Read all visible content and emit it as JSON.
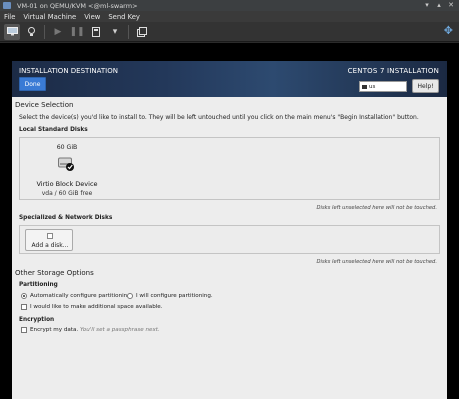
{
  "window": {
    "title": "VM-01 on QEMU/KVM <@ml-swarm>",
    "controls": [
      "▾",
      "▴",
      "✕"
    ]
  },
  "menu": [
    "File",
    "Virtual Machine",
    "View",
    "Send Key"
  ],
  "toolbar": {
    "icons": [
      "monitor-icon",
      "lightbulb-icon",
      "play-icon",
      "pause-icon",
      "power-icon",
      "dropdown-icon",
      "snapshot-icon",
      "resize-icon"
    ]
  },
  "installer": {
    "header_title": "INSTALLATION DESTINATION",
    "done_label": "Done",
    "product": "CENTOS 7 INSTALLATION",
    "keyboard_layout": "us",
    "help_label": "Help!",
    "device_selection_title": "Device Selection",
    "device_selection_desc": "Select the device(s) you'd like to install to.  They will be left untouched until you click on the main menu's \"Begin Installation\" button.",
    "local_disks_label": "Local Standard Disks",
    "disk": {
      "size": "60 GiB",
      "name": "Virtio Block Device",
      "info": "vda  /  60 GiB free"
    },
    "untouched_note": "Disks left unselected here will not be touched.",
    "specialized_label": "Specialized & Network Disks",
    "add_disk_label": "Add a disk...",
    "untouched_note_2": "Disks left unselected here will not be touched.",
    "other_options_title": "Other Storage Options",
    "partitioning_label": "Partitioning",
    "auto_partition_label": "Automatically configure partitioning.",
    "manual_partition_label": "I will configure partitioning.",
    "extra_space_label": "I would like to make additional space available.",
    "encryption_label": "Encryption",
    "encrypt_label": "Encrypt my data.",
    "encrypt_hint": "You'll set a passphrase next."
  }
}
